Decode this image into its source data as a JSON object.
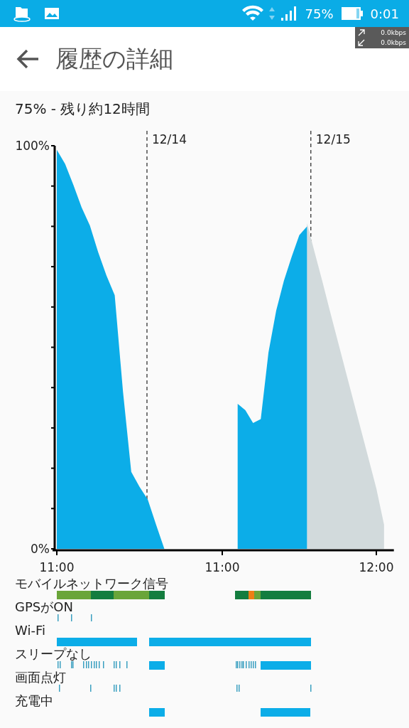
{
  "status_bar": {
    "battery": "75%",
    "time": "0:01",
    "net_up": "0.0kbps",
    "net_down": "0.0kbps"
  },
  "header": {
    "title": "履歴の詳細"
  },
  "summary": "75% - 残り約12時間",
  "chart_data": {
    "type": "area",
    "categories": [
      "11:00",
      null,
      null,
      null,
      null,
      null,
      null,
      null,
      null,
      null,
      null,
      null,
      null,
      null,
      null,
      null,
      null,
      null,
      null,
      null,
      "11:00",
      null,
      null,
      null,
      null,
      null,
      null,
      null,
      null,
      null,
      null,
      null,
      null,
      null,
      null,
      null,
      null,
      null,
      null,
      null,
      "12:00",
      null,
      null
    ],
    "series": [
      {
        "color": "#0cade8",
        "values": [
          99,
          95.5,
          90.3,
          84.7,
          80.2,
          73.6,
          67.8,
          62.9,
          39,
          19.1,
          15.4,
          12.2,
          6,
          0,
          null,
          null,
          null,
          null,
          null,
          null,
          null,
          null,
          36,
          34.4,
          31.2,
          32.2,
          48.7,
          59.1,
          66.5,
          72.4,
          77.8,
          80,
          null,
          null,
          null,
          null,
          null,
          null,
          null,
          null,
          null,
          null,
          null
        ]
      },
      {
        "color": "#d2dadc",
        "values": [
          null,
          null,
          null,
          null,
          null,
          null,
          null,
          null,
          null,
          null,
          null,
          null,
          null,
          null,
          null,
          null,
          null,
          null,
          null,
          null,
          null,
          null,
          null,
          null,
          null,
          null,
          null,
          null,
          null,
          null,
          null,
          80.8,
          73.5,
          66.3,
          58.8,
          51.5,
          44.2,
          36.9,
          29.6,
          22.3,
          15,
          6,
          null
        ]
      }
    ],
    "ylim": [
      0,
      100
    ],
    "yticks": [
      {
        "value": 0,
        "label": "0%"
      },
      {
        "value": 100,
        "label": "100%"
      }
    ],
    "annotations": [
      "12/14",
      "12/15"
    ]
  },
  "timelines": [
    {
      "kind": "signal",
      "label": "モバイルネットワーク信号"
    },
    {
      "kind": "gps",
      "label": "GPSがON"
    },
    {
      "kind": "wifi",
      "label": "Wi-Fi"
    },
    {
      "kind": "awake",
      "label": "スリープなし"
    },
    {
      "kind": "screen",
      "label": "画面点灯"
    },
    {
      "kind": "charging",
      "label": "充電中"
    }
  ]
}
